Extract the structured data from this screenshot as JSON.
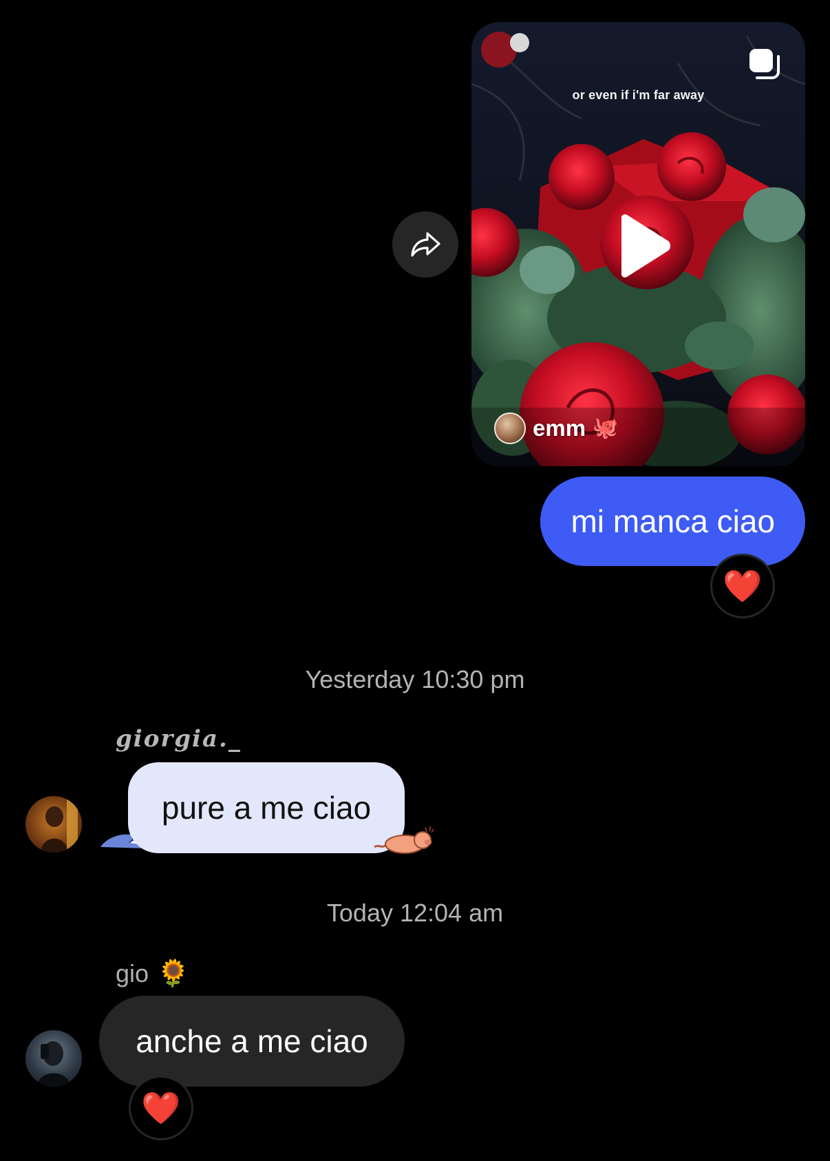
{
  "shared_reel": {
    "caption": "or even if i'm far away",
    "author": "emm",
    "author_badge_icon": "octopus-icon",
    "media_type_icon": "multi-media-icon",
    "play_icon": "play-icon"
  },
  "share_button": {
    "icon": "share-arrow-icon"
  },
  "messages": [
    {
      "id": "m1",
      "direction": "sent",
      "text": "mi manca ciao",
      "reaction": "❤️"
    },
    {
      "id": "m2",
      "direction": "received",
      "sender": "giorgia._",
      "text": "pure a me ciao",
      "bubble_color": "#e3e7fb"
    },
    {
      "id": "m3",
      "direction": "received",
      "sender": "gio",
      "sender_emoji": "🌻",
      "text": "anche a me ciao",
      "reaction": "❤️"
    }
  ],
  "timestamps": {
    "t1": "Yesterday 10:30 pm",
    "t2": "Today 12:04 am"
  },
  "colors": {
    "background": "#000000",
    "sent_bubble": "#3e5bf5",
    "received_bubble_dark": "#262626",
    "received_bubble_light": "#e3e7fb",
    "timestamp_text": "#b4b4b4",
    "reaction_heart": "#ff2d3f"
  }
}
